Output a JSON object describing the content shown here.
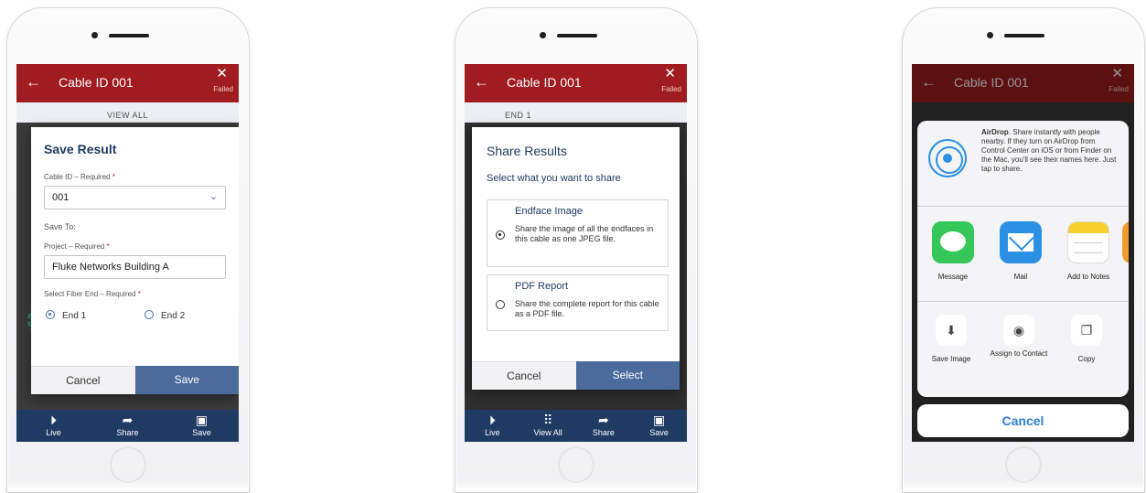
{
  "phones": {
    "save": {
      "header": {
        "back_glyph": "←",
        "title": "Cable ID 001",
        "close_glyph": "✕",
        "status": "Failed"
      },
      "strip_label": "VIEW ALL",
      "modal": {
        "title": "Save Result",
        "cable_id_label": "Cable ID – Required",
        "required_mark": "*",
        "cable_id_value": "001",
        "save_to_label": "Save To:",
        "project_label": "Project – Required",
        "project_value": "Fluke Networks Building A",
        "fiber_end_label": "Select Fiber End – Required",
        "end1_label": "End 1",
        "end2_label": "End 2",
        "selected_end": "End 1",
        "cancel_label": "Cancel",
        "primary_label": "Save"
      },
      "tabs": [
        {
          "icon": "play-circle-icon",
          "glyph": "⏵",
          "label": "Live"
        },
        {
          "icon": "share-arrow-icon",
          "glyph": "➦",
          "label": "Share"
        },
        {
          "icon": "floppy-disk-icon",
          "glyph": "▣",
          "label": "Save"
        }
      ]
    },
    "share": {
      "header": {
        "back_glyph": "←",
        "title": "Cable ID 001",
        "close_glyph": "✕",
        "status": "Failed"
      },
      "strip_label": "END 1",
      "modal": {
        "title": "Share Results",
        "subtitle": "Select what you want to share",
        "option1_title": "Endface Image",
        "option1_desc": "Share the image of all the endfaces in this cable as one JPEG file.",
        "option2_title": "PDF Report",
        "option2_desc": "Share the complete report for this cable as a PDF file.",
        "selected_option": "Endface Image",
        "cancel_label": "Cancel",
        "primary_label": "Select"
      },
      "tabs": [
        {
          "icon": "play-circle-icon",
          "glyph": "⏵",
          "label": "Live"
        },
        {
          "icon": "grid-dots-icon",
          "glyph": "⠿",
          "label": "View All"
        },
        {
          "icon": "share-arrow-icon",
          "glyph": "➦",
          "label": "Share"
        },
        {
          "icon": "floppy-disk-icon",
          "glyph": "▣",
          "label": "Save"
        }
      ]
    },
    "ios": {
      "header": {
        "back_glyph": "←",
        "title": "Cable ID 001",
        "close_glyph": "✕",
        "status": "Failed"
      },
      "airdrop": {
        "title": "AirDrop",
        "text": ". Share instantly with people nearby. If they turn on AirDrop from Control Center on iOS or from Finder on the Mac, you'll see their names here. Just tap to share."
      },
      "apps": [
        {
          "icon": "messages-app-icon",
          "label": "Message"
        },
        {
          "icon": "mail-app-icon",
          "label": "Mail"
        },
        {
          "icon": "notes-app-icon",
          "label": "Add to Notes"
        }
      ],
      "actions": [
        {
          "icon": "save-image-icon",
          "glyph": "⬇",
          "label": "Save Image"
        },
        {
          "icon": "assign-contact-icon",
          "glyph": "◉",
          "label": "Assign to Contact"
        },
        {
          "icon": "copy-icon",
          "glyph": "❐",
          "label": "Copy"
        }
      ],
      "cancel_label": "Cancel"
    }
  },
  "colors": {
    "header_red": "#a01c20",
    "tabbar_navy": "#1f3a63",
    "primary_button": "#4a6b9c",
    "ios_blue": "#2b7fd3"
  }
}
